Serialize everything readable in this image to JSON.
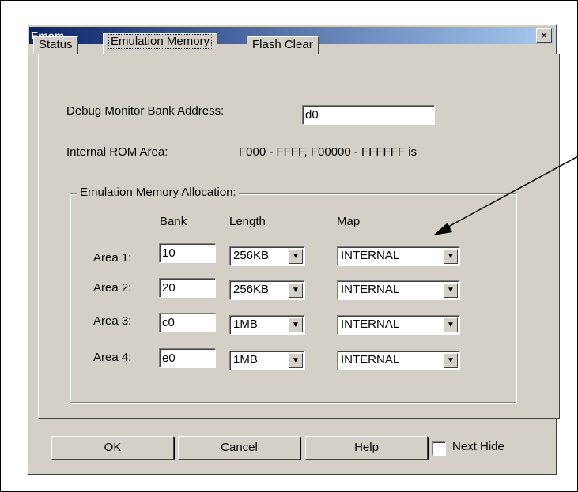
{
  "window": {
    "title": "Emem",
    "close_glyph": "×"
  },
  "tabs": [
    {
      "label": "Status"
    },
    {
      "label": "Emulation Memory"
    },
    {
      "label": "Flash Clear"
    }
  ],
  "debug_monitor": {
    "label": "Debug Monitor Bank Address:",
    "value": "d0"
  },
  "internal_rom": {
    "label": "Internal ROM Area:",
    "value": "F000 - FFFF, F00000 - FFFFFF is"
  },
  "allocation": {
    "group_label": "Emulation Memory Allocation:",
    "headers": {
      "bank": "Bank",
      "length": "Length",
      "map": "Map"
    },
    "areas": [
      {
        "label": "Area 1:",
        "bank": "10",
        "length": "256KB",
        "map": "INTERNAL"
      },
      {
        "label": "Area 2:",
        "bank": "20",
        "length": "256KB",
        "map": "INTERNAL"
      },
      {
        "label": "Area 3:",
        "bank": "c0",
        "length": "1MB",
        "map": "INTERNAL"
      },
      {
        "label": "Area 4:",
        "bank": "e0",
        "length": "1MB",
        "map": "INTERNAL"
      }
    ]
  },
  "buttons": {
    "ok": "OK",
    "cancel": "Cancel",
    "help": "Help"
  },
  "next_hide": {
    "label": "Next Hide",
    "checked": false
  },
  "annotation": {
    "arrow_color": "#000000"
  }
}
